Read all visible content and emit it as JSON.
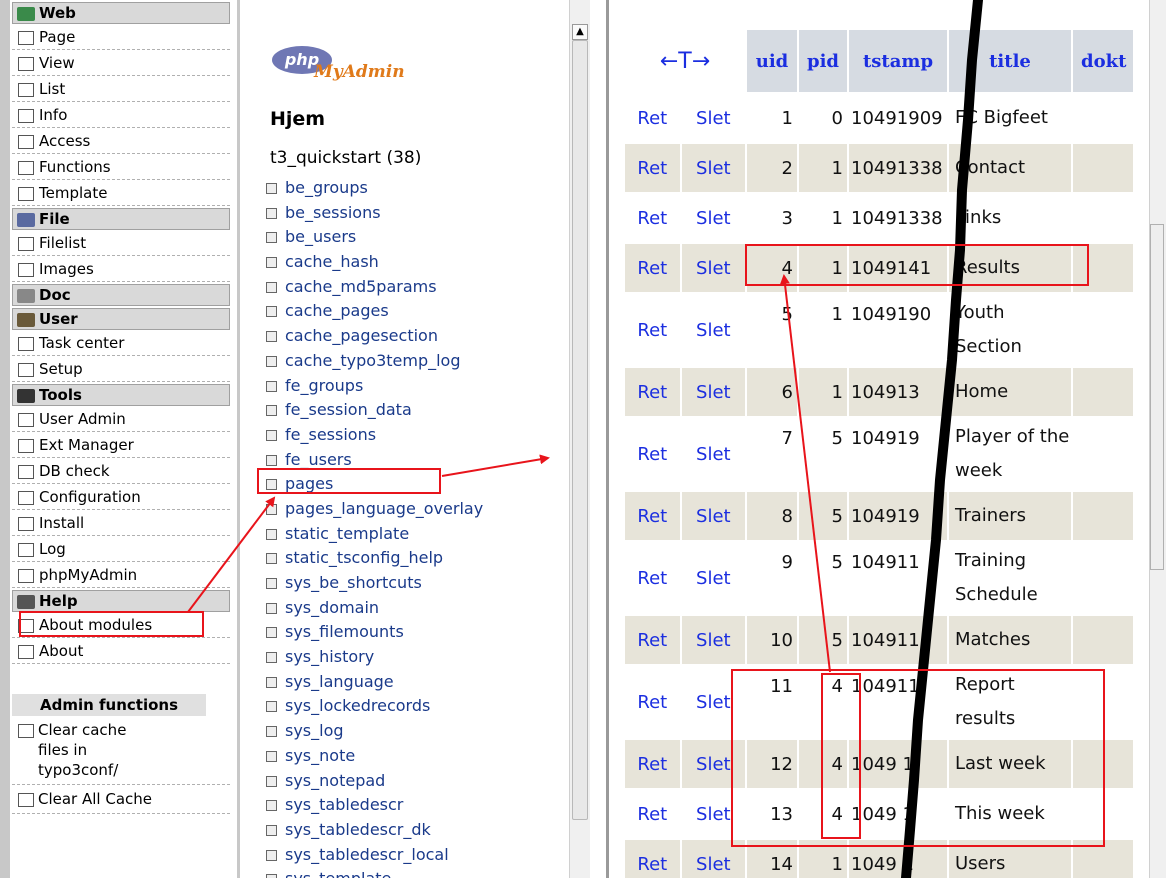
{
  "menu": {
    "groups": [
      {
        "label": "Web",
        "icon": "globe-icon",
        "items": [
          {
            "label": "Page",
            "icon": "page-icon"
          },
          {
            "label": "View",
            "icon": "magnifier-icon"
          },
          {
            "label": "List",
            "icon": "list-icon"
          },
          {
            "label": "Info",
            "icon": "info-icon"
          },
          {
            "label": "Access",
            "icon": "access-icon"
          },
          {
            "label": "Functions",
            "icon": "functions-icon"
          },
          {
            "label": "Template",
            "icon": "template-icon"
          }
        ]
      },
      {
        "label": "File",
        "icon": "drive-icon",
        "items": [
          {
            "label": "Filelist",
            "icon": "filelist-icon"
          },
          {
            "label": "Images",
            "icon": "images-icon"
          }
        ]
      },
      {
        "label": "Doc",
        "icon": "doc-icon",
        "items": []
      },
      {
        "label": "User",
        "icon": "user-icon",
        "items": [
          {
            "label": "Task center",
            "icon": "task-center-icon"
          },
          {
            "label": "Setup",
            "icon": "setup-icon"
          }
        ]
      },
      {
        "label": "Tools",
        "icon": "tools-icon",
        "items": [
          {
            "label": "User Admin",
            "icon": "user-admin-icon"
          },
          {
            "label": "Ext Manager",
            "icon": "ext-manager-icon"
          },
          {
            "label": "DB check",
            "icon": "db-check-icon"
          },
          {
            "label": "Configuration",
            "icon": "configuration-icon"
          },
          {
            "label": "Install",
            "icon": "install-icon"
          },
          {
            "label": "Log",
            "icon": "log-icon"
          },
          {
            "label": "phpMyAdmin",
            "icon": "phpmyadmin-icon"
          }
        ]
      },
      {
        "label": "Help",
        "icon": "help-icon",
        "items": [
          {
            "label": "About modules",
            "icon": "help-box-icon"
          },
          {
            "label": "About",
            "icon": "about-icon"
          }
        ]
      }
    ],
    "admin_heading": "Admin functions",
    "admin_items": [
      {
        "line1": "Clear cache",
        "line2": "files in",
        "line3": "typo3conf/"
      },
      {
        "line1": "Clear All Cache",
        "line2": "",
        "line3": ""
      }
    ]
  },
  "tables": {
    "logo_php": "php",
    "logo_myadmin": "MyAdmin",
    "home_label": "Hjem",
    "db_name": "t3_quickstart",
    "db_count": "(38)",
    "items": [
      "be_groups",
      "be_sessions",
      "be_users",
      "cache_hash",
      "cache_md5params",
      "cache_pages",
      "cache_pagesection",
      "cache_typo3temp_log",
      "fe_groups",
      "fe_session_data",
      "fe_sessions",
      "fe_users",
      "pages",
      "pages_language_overlay",
      "static_template",
      "static_tsconfig_help",
      "sys_be_shortcuts",
      "sys_domain",
      "sys_filemounts",
      "sys_history",
      "sys_language",
      "sys_lockedrecords",
      "sys_log",
      "sys_note",
      "sys_notepad",
      "sys_tabledescr",
      "sys_tabledescr_dk",
      "sys_tabledescr_local",
      "sys_template"
    ]
  },
  "grid": {
    "nav_label": "←T→",
    "columns": [
      "uid",
      "pid",
      "tstamp",
      "title",
      "dokt"
    ],
    "edit_label": "Ret",
    "delete_label": "Slet",
    "rows": [
      {
        "uid": "1",
        "pid": "0",
        "tstamp": "10491909",
        "title": "FC Bigfeet"
      },
      {
        "uid": "2",
        "pid": "1",
        "tstamp": "10491338",
        "title": "Contact"
      },
      {
        "uid": "3",
        "pid": "1",
        "tstamp": "10491338",
        "title": "Links"
      },
      {
        "uid": "4",
        "pid": "1",
        "tstamp": "1049141",
        "title": "Results"
      },
      {
        "uid": "5",
        "pid": "1",
        "tstamp": "1049190",
        "title": "Youth Section"
      },
      {
        "uid": "6",
        "pid": "1",
        "tstamp": "104913",
        "title": "Home"
      },
      {
        "uid": "7",
        "pid": "5",
        "tstamp": "104919",
        "title": "Player of the week"
      },
      {
        "uid": "8",
        "pid": "5",
        "tstamp": "104919",
        "title": "Trainers"
      },
      {
        "uid": "9",
        "pid": "5",
        "tstamp": "104911",
        "title": "Training Schedule"
      },
      {
        "uid": "10",
        "pid": "5",
        "tstamp": "104911",
        "title": "Matches"
      },
      {
        "uid": "11",
        "pid": "4",
        "tstamp": "104911",
        "title": "Report results"
      },
      {
        "uid": "12",
        "pid": "4",
        "tstamp": "1049 1",
        "title": "Last week"
      },
      {
        "uid": "13",
        "pid": "4",
        "tstamp": "1049 1",
        "title": "This week"
      },
      {
        "uid": "14",
        "pid": "1",
        "tstamp": "1049 1",
        "title": "Users"
      }
    ]
  },
  "colors": {
    "link_blue": "#1b2ee0",
    "annotation_red": "#e8141b",
    "row_alt": "#e7e4d9"
  }
}
